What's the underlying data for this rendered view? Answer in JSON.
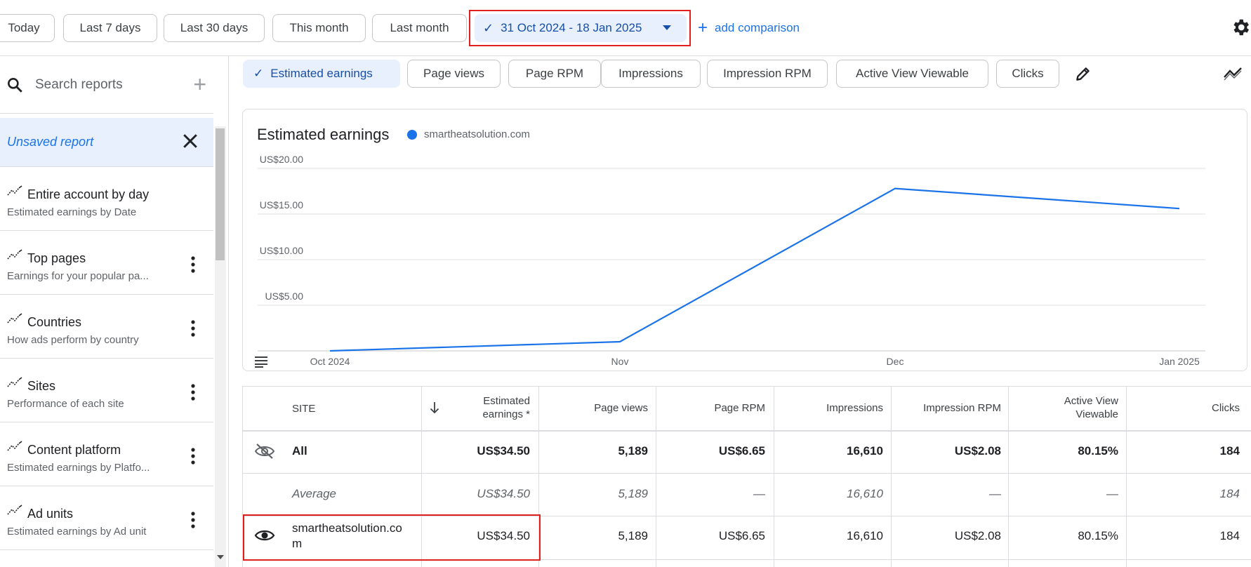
{
  "date_bar": {
    "presets": [
      "Today",
      "Last 7 days",
      "Last 30 days",
      "This month",
      "Last month"
    ],
    "range_label": "31 Oct 2024 - 18 Jan 2025",
    "add_comparison": "add comparison"
  },
  "sidebar": {
    "search_placeholder": "Search reports",
    "unsaved_label": "Unsaved report",
    "reports": [
      {
        "title": "Entire account by day",
        "subtitle": "Estimated earnings by Date"
      },
      {
        "title": "Top pages",
        "subtitle": "Earnings for your popular pa..."
      },
      {
        "title": "Countries",
        "subtitle": "How ads perform by country"
      },
      {
        "title": "Sites",
        "subtitle": "Performance of each site"
      },
      {
        "title": "Content platform",
        "subtitle": "Estimated earnings by Platfo..."
      },
      {
        "title": "Ad units",
        "subtitle": "Estimated earnings by Ad unit"
      }
    ]
  },
  "metrics": [
    "Estimated earnings",
    "Page views",
    "Page RPM",
    "Impressions",
    "Impression RPM",
    "Active View Viewable",
    "Clicks"
  ],
  "chart_data": {
    "type": "line",
    "title": "Estimated earnings",
    "x": [
      "Oct 2024",
      "Nov",
      "Dec",
      "Jan 2025"
    ],
    "y_ticks": [
      "US$20.00",
      "US$15.00",
      "US$10.00",
      "US$5.00"
    ],
    "ylim": [
      0,
      20
    ],
    "series": [
      {
        "name": "smartheatsolution.com",
        "color": "#1a73e8",
        "values": [
          0.0,
          1.0,
          17.8,
          15.6
        ]
      }
    ],
    "legend": "top-left"
  },
  "table": {
    "headers": {
      "site": "SITE",
      "earnings_l1": "Estimated",
      "earnings_l2": "earnings *",
      "page_views": "Page views",
      "page_rpm": "Page RPM",
      "impressions": "Impressions",
      "impression_rpm": "Impression RPM",
      "viewable_l1": "Active View",
      "viewable_l2": "Viewable",
      "clicks": "Clicks"
    },
    "all": {
      "site": "All",
      "earnings": "US$34.50",
      "page_views": "5,189",
      "page_rpm": "US$6.65",
      "impressions": "16,610",
      "impression_rpm": "US$2.08",
      "viewable": "80.15%",
      "clicks": "184"
    },
    "average": {
      "site": "Average",
      "earnings": "US$34.50",
      "page_views": "5,189",
      "page_rpm": "—",
      "impressions": "16,610",
      "impression_rpm": "—",
      "viewable": "—",
      "clicks": "184"
    },
    "row": {
      "site_l1": "smartheatsolution.co",
      "site_l2": "m",
      "earnings": "US$34.50",
      "page_views": "5,189",
      "page_rpm": "US$6.65",
      "impressions": "16,610",
      "impression_rpm": "US$2.08",
      "viewable": "80.15%",
      "clicks": "184"
    }
  }
}
